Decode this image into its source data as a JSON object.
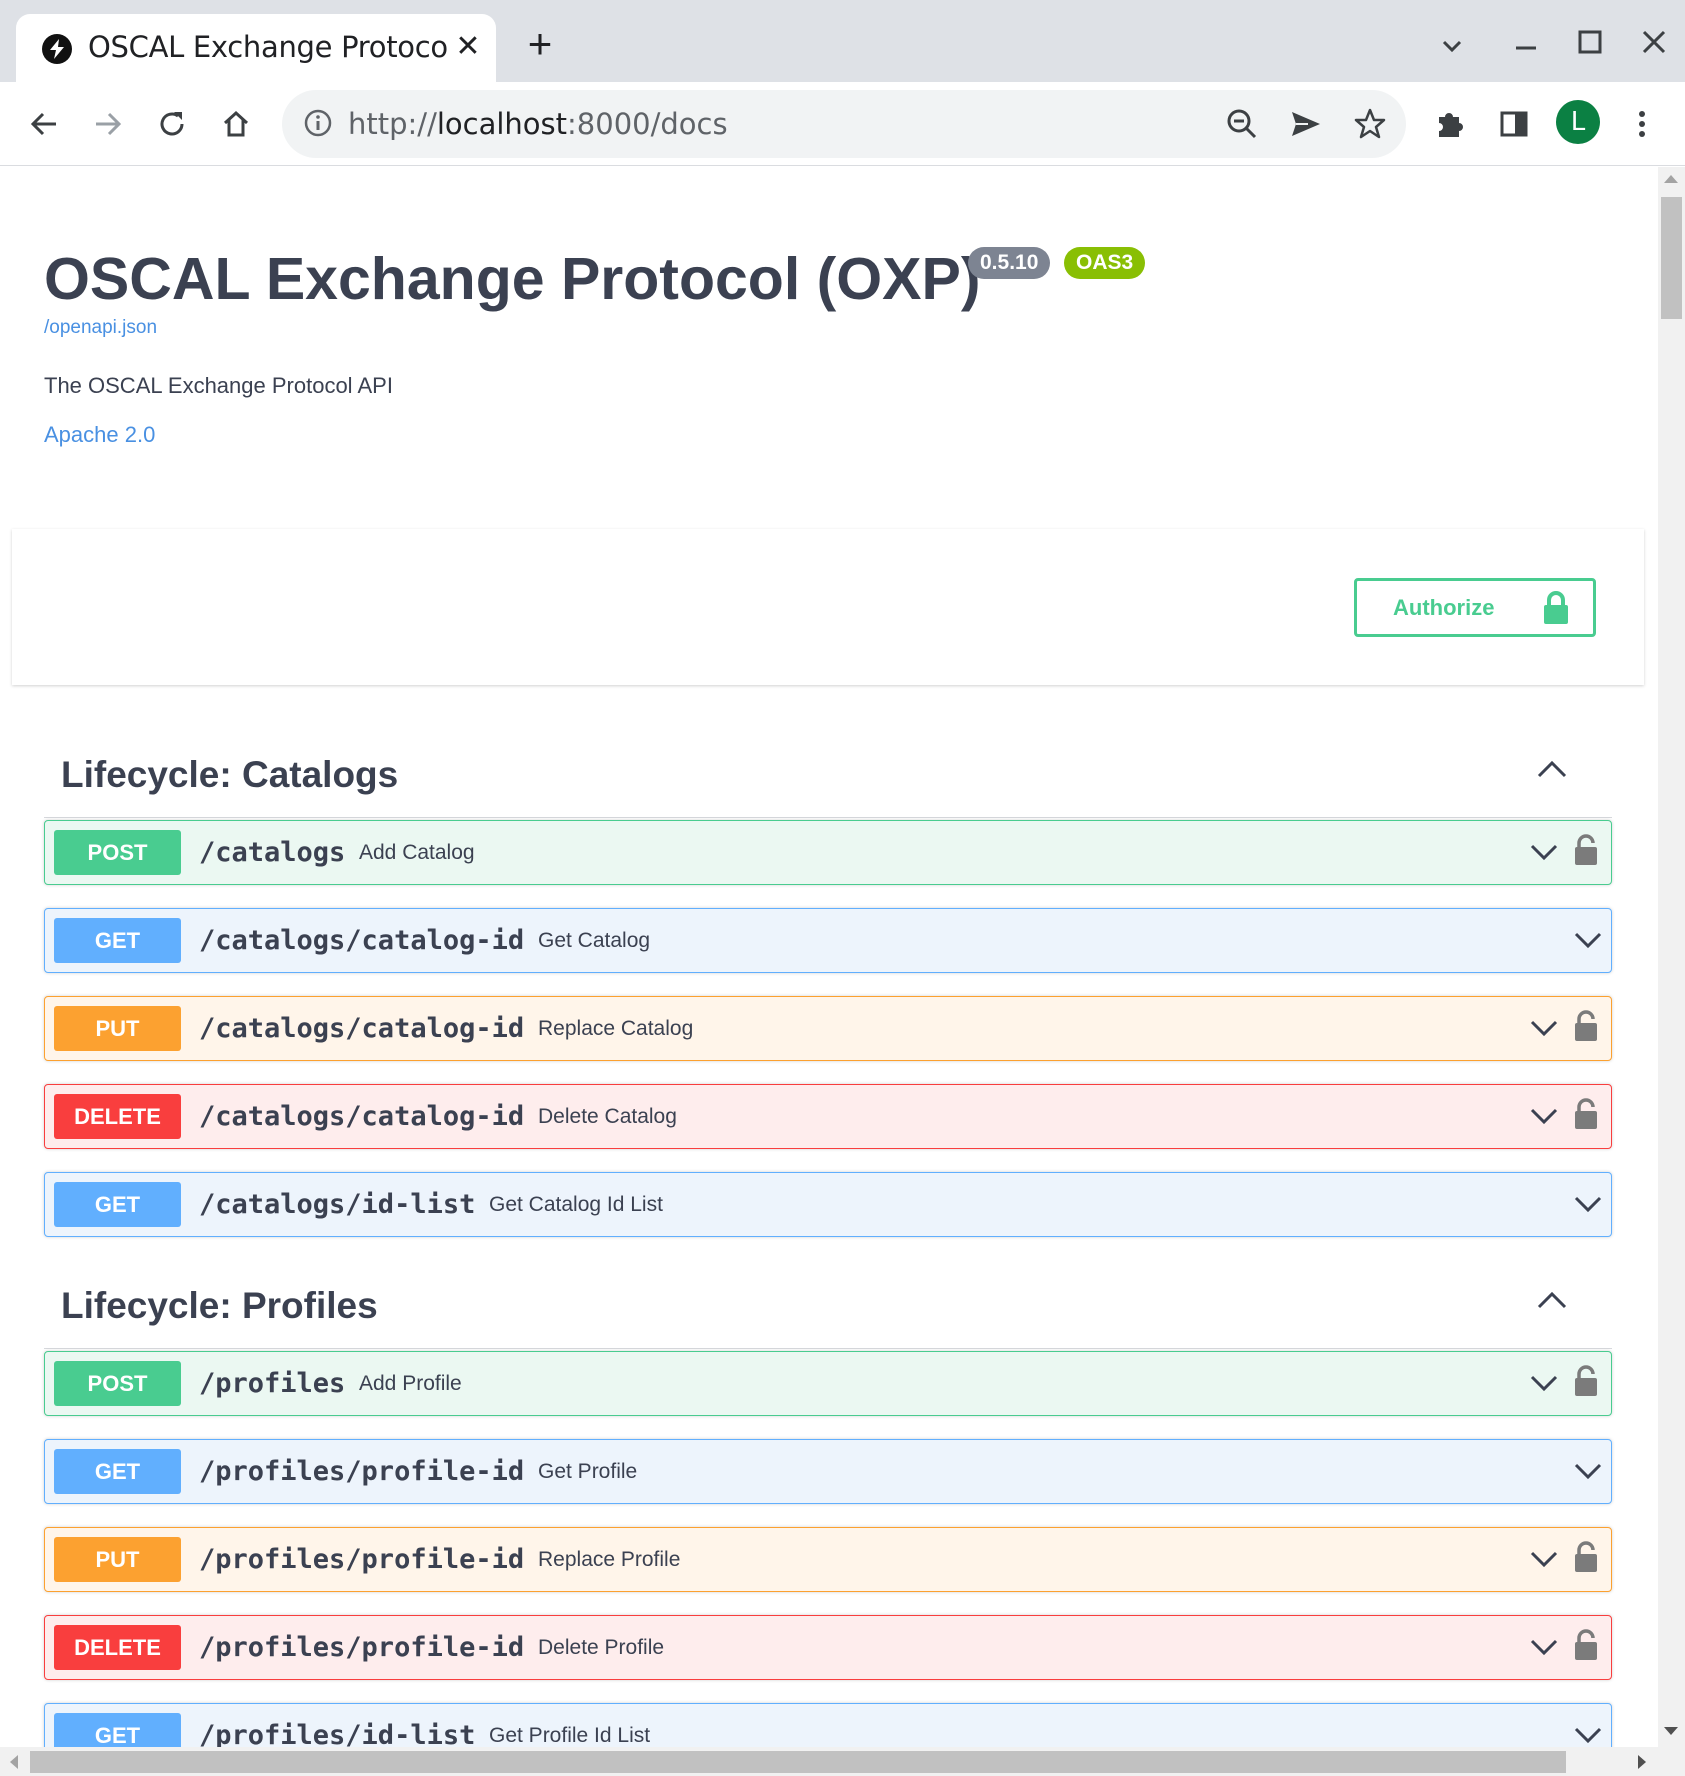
{
  "browser": {
    "tab_title": "OSCAL Exchange Protocol",
    "url_scheme": "http://",
    "url_host": "localhost",
    "url_rest": ":8000/docs",
    "profile_initial": "L",
    "avatar_color": "#0b8043"
  },
  "info": {
    "title": "OSCAL Exchange Protocol (OXP)",
    "version": "0.5.10",
    "oas_badge": "OAS3",
    "spec_link": "/openapi.json",
    "description": "The OSCAL Exchange Protocol API",
    "license": "Apache 2.0"
  },
  "authorize": {
    "label": "Authorize"
  },
  "colors": {
    "post": "#49cc90",
    "get": "#61affe",
    "put": "#fca130",
    "delete": "#f93e3e",
    "text": "#3b4151",
    "link": "#4990e2"
  },
  "icons": {
    "tab_favicon": "bolt-icon",
    "lock": "lock-icon",
    "expand": "chevron-down-icon",
    "collapse": "chevron-up-icon"
  },
  "tags": [
    {
      "title": "Lifecycle: Catalogs",
      "operations": [
        {
          "method": "POST",
          "path": "/catalogs",
          "summary": "Add Catalog",
          "locked": true
        },
        {
          "method": "GET",
          "path": "/catalogs/catalog-id",
          "summary": "Get Catalog",
          "locked": false
        },
        {
          "method": "PUT",
          "path": "/catalogs/catalog-id",
          "summary": "Replace Catalog",
          "locked": true
        },
        {
          "method": "DELETE",
          "path": "/catalogs/catalog-id",
          "summary": "Delete Catalog",
          "locked": true
        },
        {
          "method": "GET",
          "path": "/catalogs/id-list",
          "summary": "Get Catalog Id List",
          "locked": false
        }
      ]
    },
    {
      "title": "Lifecycle: Profiles",
      "operations": [
        {
          "method": "POST",
          "path": "/profiles",
          "summary": "Add Profile",
          "locked": true
        },
        {
          "method": "GET",
          "path": "/profiles/profile-id",
          "summary": "Get Profile",
          "locked": false
        },
        {
          "method": "PUT",
          "path": "/profiles/profile-id",
          "summary": "Replace Profile",
          "locked": true
        },
        {
          "method": "DELETE",
          "path": "/profiles/profile-id",
          "summary": "Delete Profile",
          "locked": true
        },
        {
          "method": "GET",
          "path": "/profiles/id-list",
          "summary": "Get Profile Id List",
          "locked": false
        }
      ]
    }
  ]
}
